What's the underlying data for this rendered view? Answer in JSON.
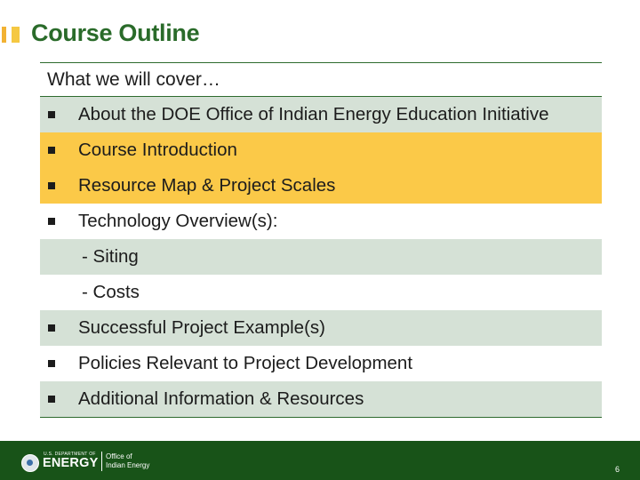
{
  "title": "Course Outline",
  "outline": {
    "header": "What we will cover…",
    "items": [
      {
        "text": "About the DOE Office of Indian Energy Education Initiative",
        "bullet": true,
        "style": "green"
      },
      {
        "text": "Course Introduction",
        "bullet": true,
        "style": "gold"
      },
      {
        "text": "Resource Map & Project Scales",
        "bullet": true,
        "style": "gold"
      },
      {
        "text": "Technology Overview(s):",
        "bullet": true,
        "style": "white"
      },
      {
        "text": "- Siting",
        "bullet": false,
        "style": "green"
      },
      {
        "text": "- Costs",
        "bullet": false,
        "style": "white"
      },
      {
        "text": "Successful Project Example(s)",
        "bullet": true,
        "style": "green"
      },
      {
        "text": "Policies Relevant to Project Development",
        "bullet": true,
        "style": "white"
      },
      {
        "text": "Additional Information & Resources",
        "bullet": true,
        "style": "green"
      }
    ]
  },
  "footer": {
    "logo_small_text": "U.S. DEPARTMENT OF",
    "logo_big_text": "ENERGY",
    "office_line1": "Office of",
    "office_line2": "Indian Energy",
    "page_number": "6"
  },
  "colors": {
    "title_green": "#2a6b2a",
    "row_green": "#d5e1d6",
    "row_gold": "#fbc948",
    "footer_green": "#185318",
    "accent_gold": "#f5c842"
  }
}
